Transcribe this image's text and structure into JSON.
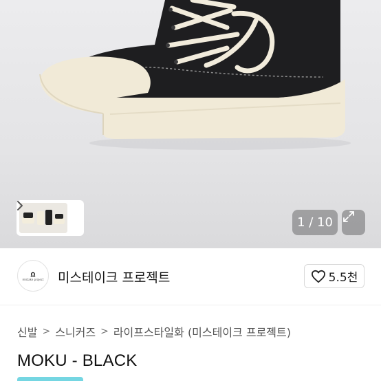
{
  "gallery": {
    "current": "1",
    "separator": "/",
    "total": "10",
    "counter_text": "1 / 10"
  },
  "icons": {
    "thumbnail_next": "chevron-right-icon",
    "expand": "expand-arrows-icon",
    "like": "heart-outline-icon"
  },
  "seller": {
    "logo_mark": "ꭥ",
    "logo_caption": "mistake project",
    "name": "미스테이크 프로젝트",
    "like_count": "5.5천"
  },
  "breadcrumb": {
    "items": [
      "신발",
      "스니커즈",
      "라이프스타일화 (미스테이크 프로젝트)"
    ],
    "separator": ">"
  },
  "product": {
    "title": "MOKU - BLACK"
  },
  "colors": {
    "background": "#ffffff",
    "hero_bg": "#e6e6e8",
    "sole_cream": "#f1ead7",
    "upper_black": "#1e1e20",
    "text_primary": "#111111",
    "text_secondary": "#555555",
    "accent_tag": "#3ac4d6"
  }
}
